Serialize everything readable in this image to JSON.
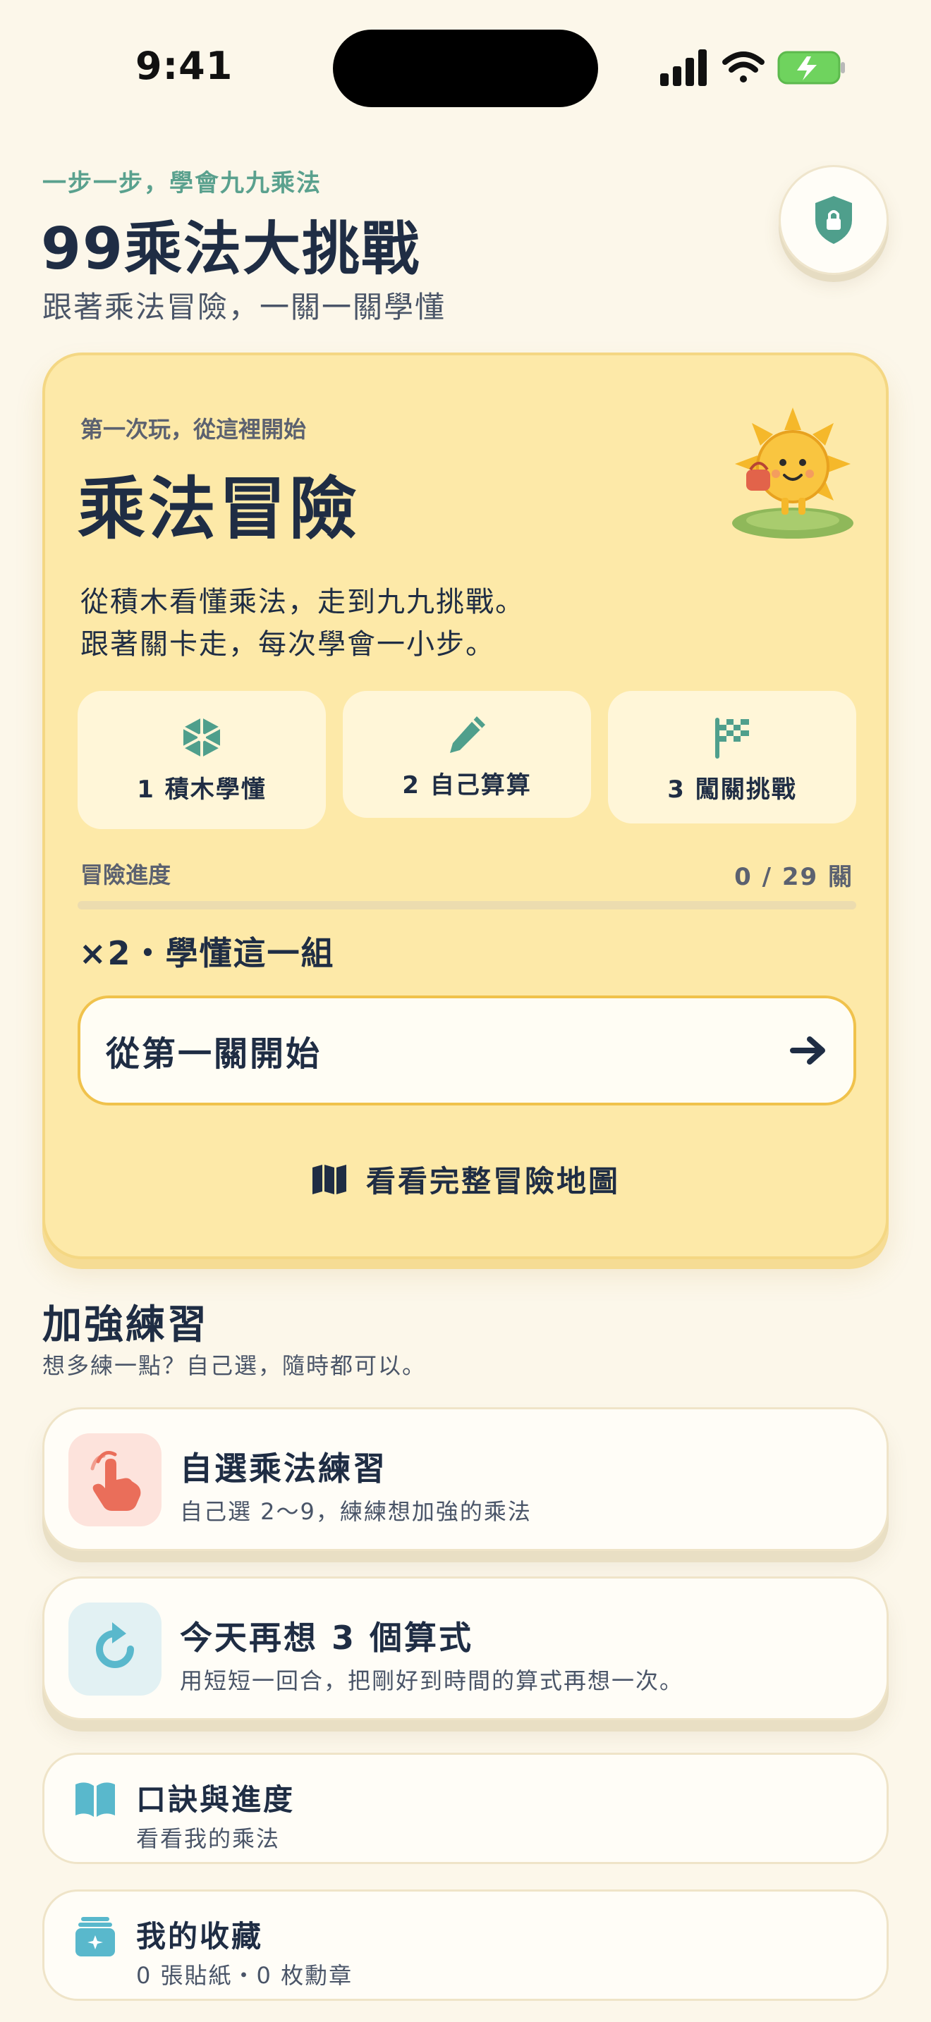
{
  "status_bar": {
    "time": "9:41"
  },
  "header": {
    "kicker": "一步一步，學會九九乘法",
    "title": "99乘法大挑戰",
    "subtitle": "跟著乘法冒險，一關一關學懂"
  },
  "adventure": {
    "kicker": "第一次玩，從這裡開始",
    "title": "乘法冒險",
    "description_line1": "從積木看懂乘法，走到九九挑戰。",
    "description_line2": "跟著關卡走，每次學會一小步。",
    "steps": [
      {
        "label": "1 積木學懂",
        "icon": "cube-icon"
      },
      {
        "label": "2 自己算算",
        "icon": "pencil-icon"
      },
      {
        "label": "3 闖關挑戰",
        "icon": "flag-icon"
      }
    ],
    "progress_label": "冒險進度",
    "progress_count": "0 / 29 關",
    "progress_value": 0,
    "current_group": "×2・學懂這一組",
    "start_button": "從第一關開始",
    "map_link": "看看完整冒險地圖"
  },
  "practice": {
    "title": "加強練習",
    "subtitle": "想多練一點？自己選，隨時都可以。",
    "cards": [
      {
        "title": "自選乘法練習",
        "subtitle": "自己選 2～9，練練想加強的乘法",
        "icon": "tap-hand-icon"
      },
      {
        "title": "今天再想 3 個算式",
        "subtitle": "用短短一回合，把剛好到時間的算式再想一次。",
        "icon": "refresh-icon"
      }
    ],
    "links": [
      {
        "title": "口訣與進度",
        "subtitle": "看看我的乘法",
        "icon": "book-icon"
      },
      {
        "title": "我的收藏",
        "subtitle": "0 張貼紙・0 枚勳章",
        "icon": "collection-box-icon"
      }
    ]
  },
  "colors": {
    "background": "#fcf7ea",
    "card_yellow": "#fde9a8",
    "accent_teal": "#5aa18e",
    "accent_orange": "#f2a640",
    "text_dark": "#1f2d44"
  }
}
